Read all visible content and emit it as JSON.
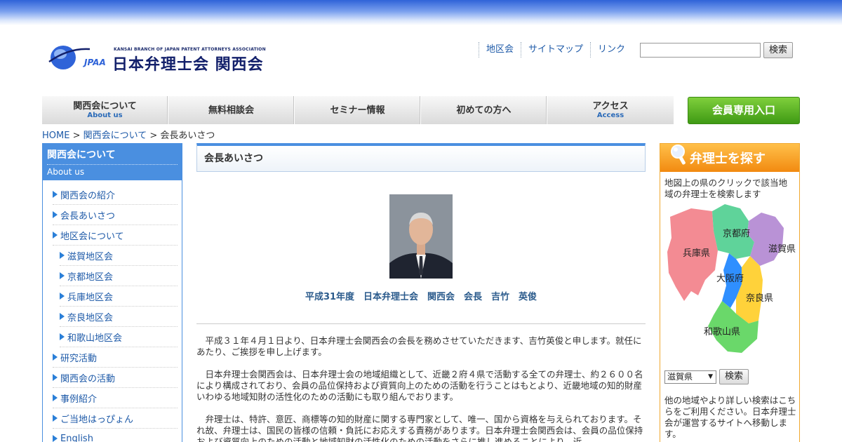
{
  "header": {
    "logo_sub": "KANSAI BRANCH OF JAPAN PATENT ATTORNEYS ASSOCIATION",
    "logo_main": "日本弁理士会 関西会",
    "logo_jpaa": "JPAA",
    "links": [
      "地区会",
      "サイトマップ",
      "リンク"
    ],
    "search_button": "検索",
    "search_value": ""
  },
  "nav": [
    {
      "jp": "関西会について",
      "en": "About us"
    },
    {
      "jp": "無料相談会",
      "en": ""
    },
    {
      "jp": "セミナー情報",
      "en": ""
    },
    {
      "jp": "初めての方へ",
      "en": ""
    },
    {
      "jp": "アクセス",
      "en": "Access"
    }
  ],
  "member_button": "会員専用入口",
  "breadcrumb": {
    "home": "HOME",
    "sep1": " > ",
    "parent": "関西会について",
    "sep2": " > ",
    "current": "会長あいさつ"
  },
  "sidebar": {
    "title": "関西会について",
    "title_en": "About us",
    "items": [
      "関西会の紹介",
      "会長あいさつ",
      "地区会について",
      "滋賀地区会",
      "京都地区会",
      "兵庫地区会",
      "奈良地区会",
      "和歌山地区会",
      "研究活動",
      "関西会の活動",
      "事例紹介",
      "ご当地はっぴょん",
      "English"
    ]
  },
  "main": {
    "title": "会長あいさつ",
    "caption": "平成31年度　日本弁理士会　関西会　会長　吉竹　英俊",
    "paragraphs": [
      "平成３１年４月１日より、日本弁理士会関西会の会長を務めさせていただきます、吉竹英俊と申します。就任にあたり、ご挨拶を申し上げます。",
      "日本弁理士会関西会は、日本弁理士会の地域組織として、近畿２府４県で活動する全ての弁理士、約２６００名により構成されており、会員の品位保持および資質向上のための活動を行うことはもとより、近畿地域の知的財産いわゆる地域知財の活性化のための活動にも取り組んでおります。",
      "弁理士は、特許、意匠、商標等の知的財産に関する専門家として、唯一、国から資格を与えられております。それ故、弁理士は、国民の皆様の信頼・負託にお応えする責務があります。日本弁理士会関西会は、会員の品位保持および資質向上のための活動と地域知財の活性化のための活動をさらに推し進めることにより、近"
    ]
  },
  "right": {
    "title": "弁理士を探す",
    "intro": "地図上の県のクリックで該当地域の弁理士を検索します",
    "prefectures": [
      "京都府",
      "滋賀県",
      "兵庫県",
      "大阪府",
      "奈良県",
      "和歌山県"
    ],
    "select_value": "滋賀県",
    "search_button": "検索",
    "more_text": "他の地域やより詳しい検索はこちらをご利用ください。日本弁理士会が運営するサイトへ移動します。"
  }
}
